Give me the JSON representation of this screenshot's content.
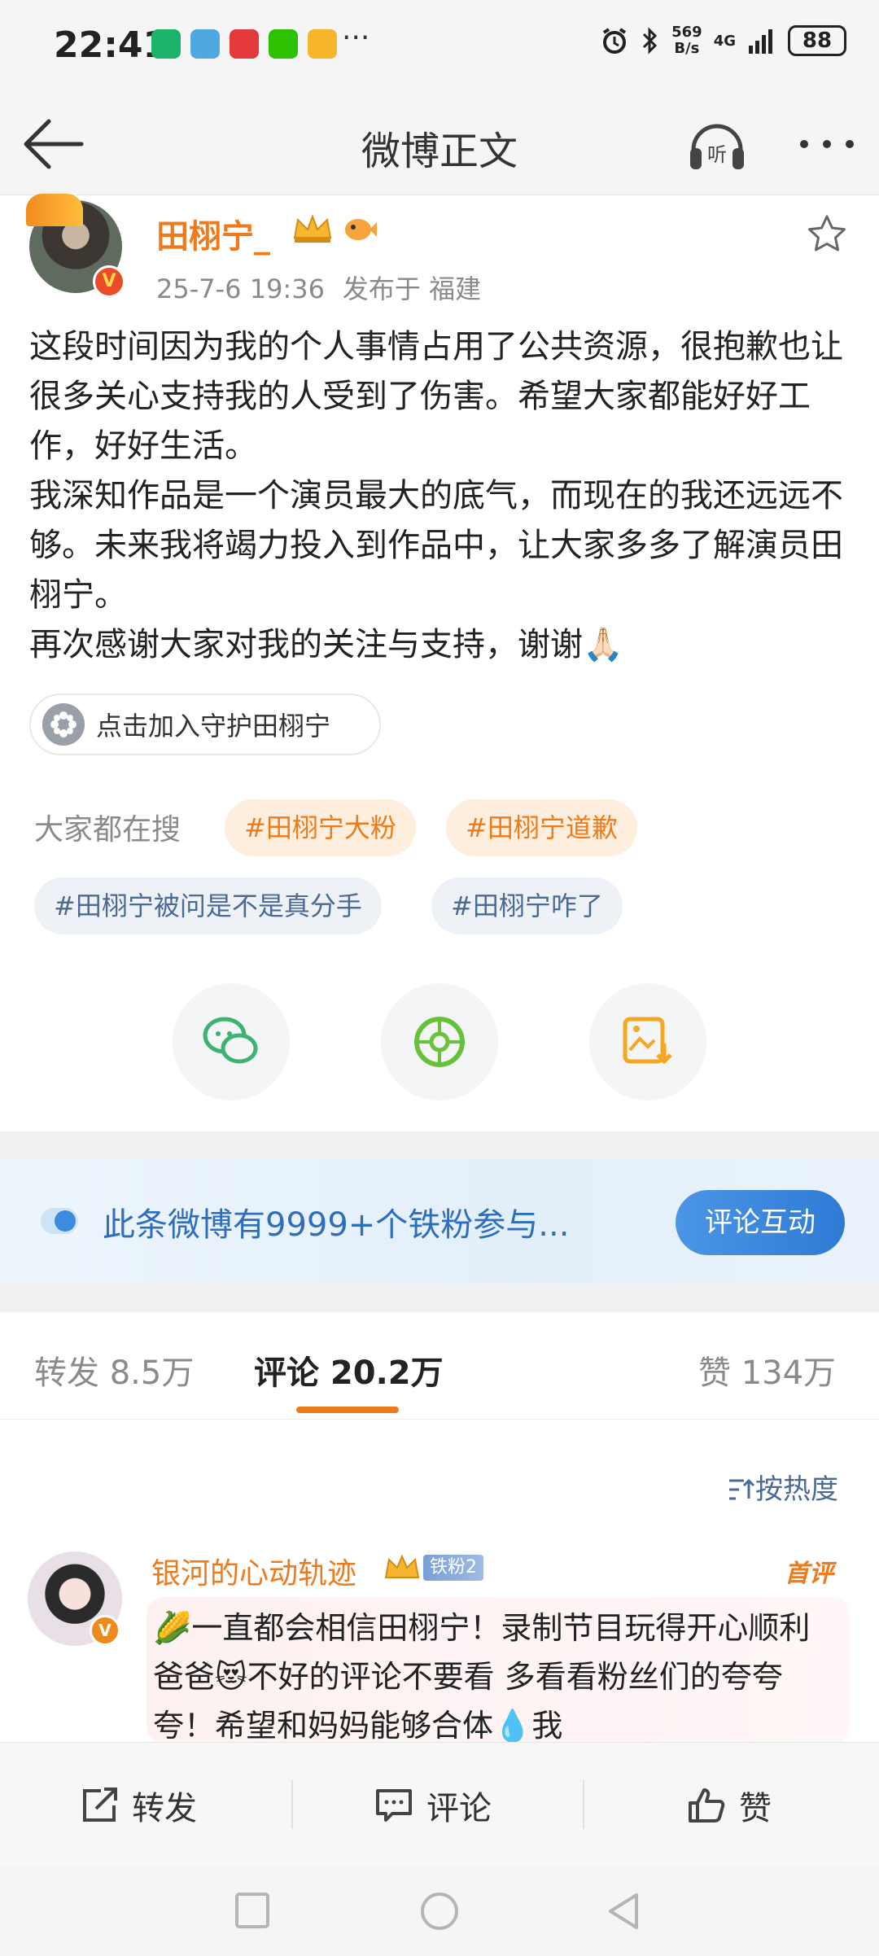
{
  "status_bar": {
    "time": "22:41",
    "net_speed_value": "569",
    "net_speed_unit": "B/s",
    "network": "4G",
    "battery": "88"
  },
  "header": {
    "title": "微博正文",
    "listen_label": "听"
  },
  "post": {
    "author": "田栩宁_",
    "timestamp": "25-7-6 19:36",
    "location": "发布于 福建",
    "paragraphs": [
      "这段时间因为我的个人事情占用了公共资源，很抱歉也让很多关心支持我的人受到了伤害。希望大家都能好好工作，好好生活。",
      "我深知作品是一个演员最大的底气，而现在的我还远远不够。未来我将竭力投入到作品中，让大家多多了解演员田栩宁。",
      "再次感谢大家对我的关注与支持，谢谢🙏🏻"
    ],
    "guard_button": "点击加入守护田栩宁"
  },
  "trending": {
    "label": "大家都在搜",
    "tags": [
      "#田栩宁大粉",
      "#田栩宁道歉",
      "#田栩宁被问是不是真分手",
      "#田栩宁咋了"
    ]
  },
  "fans_banner": {
    "text": "此条微博有9999+个铁粉参与...",
    "button": "评论互动"
  },
  "tabs": {
    "repost": "转发 8.5万",
    "comments": "评论 20.2万",
    "likes": "赞 134万"
  },
  "sort_label": "按热度",
  "comment": {
    "user": "银河的心动轨迹",
    "badge": "铁粉2",
    "first_label": "首评",
    "text": "🌽一直都会相信田栩宁！录制节目玩得开心顺利爸爸😻不好的评论不要看 多看看粉丝们的夸夸夸！希望和妈妈能够合体💧我"
  },
  "actions": {
    "repost": "转发",
    "comment": "评论",
    "like": "赞"
  },
  "colors": {
    "accent_orange": "#ed7b1c",
    "link_blue": "#4a6a95",
    "banner_blue": "#2f6dbd"
  }
}
